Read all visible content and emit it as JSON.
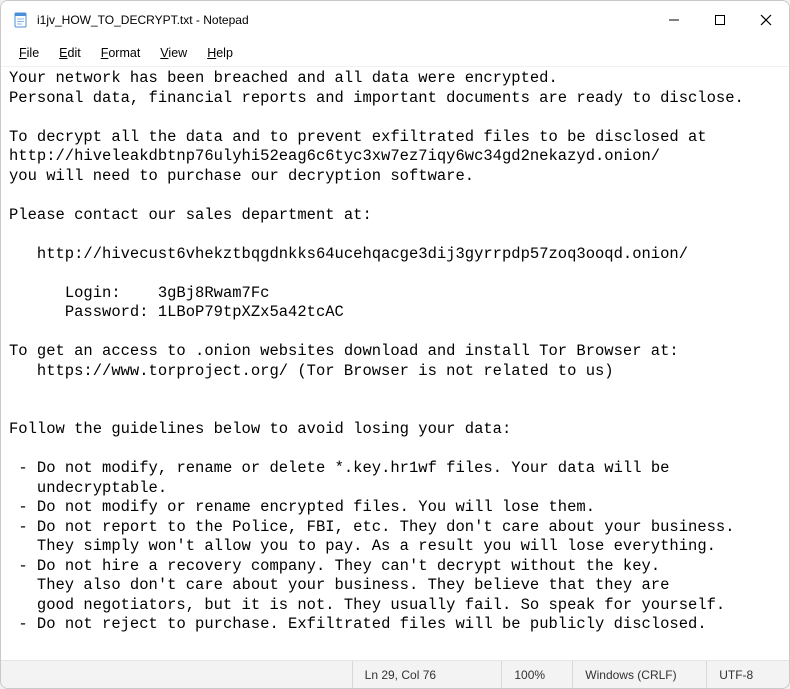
{
  "titlebar": {
    "title": "i1jv_HOW_TO_DECRYPT.txt - Notepad"
  },
  "window_controls": {
    "minimize": "Minimize",
    "maximize": "Maximize",
    "close": "Close"
  },
  "menu": {
    "file": "File",
    "edit": "Edit",
    "format": "Format",
    "view": "View",
    "help": "Help"
  },
  "doc": {
    "line1": "Your network has been breached and all data were encrypted.",
    "line2": "Personal data, financial reports and important documents are ready to disclose.",
    "blank1": "",
    "line3": "To decrypt all the data and to prevent exfiltrated files to be disclosed at",
    "line4": "http://hiveleakdbtnp76ulyhi52eag6c6tyc3xw7ez7iqy6wc34gd2nekazyd.onion/",
    "line5": "you will need to purchase our decryption software.",
    "blank2": "",
    "line6": "Please contact our sales department at:",
    "blank3": "",
    "line7": "   http://hivecust6vhekztbqgdnkks64ucehqacge3dij3gyrrpdp57zoq3ooqd.onion/",
    "blank4": "",
    "line8": "      Login:    3gBj8Rwam7Fc",
    "line9": "      Password: 1LBoP79tpXZx5a42tcAC",
    "blank5": "",
    "line10": "To get an access to .onion websites download and install Tor Browser at:",
    "line11": "   https://www.torproject.org/ (Tor Browser is not related to us)",
    "blank6": "",
    "blank7": "",
    "line12": "Follow the guidelines below to avoid losing your data:",
    "blank8": "",
    "line13": " - Do not modify, rename or delete *.key.hr1wf files. Your data will be",
    "line14": "   undecryptable.",
    "line15": " - Do not modify or rename encrypted files. You will lose them.",
    "line16": " - Do not report to the Police, FBI, etc. They don't care about your business.",
    "line17": "   They simply won't allow you to pay. As a result you will lose everything.",
    "line18": " - Do not hire a recovery company. They can't decrypt without the key.",
    "line19": "   They also don't care about your business. They believe that they are",
    "line20": "   good negotiators, but it is not. They usually fail. So speak for yourself.",
    "line21": " - Do not reject to purchase. Exfiltrated files will be publicly disclosed."
  },
  "status": {
    "position": "Ln 29, Col 76",
    "zoom": "100%",
    "eol": "Windows (CRLF)",
    "encoding": "UTF-8"
  }
}
